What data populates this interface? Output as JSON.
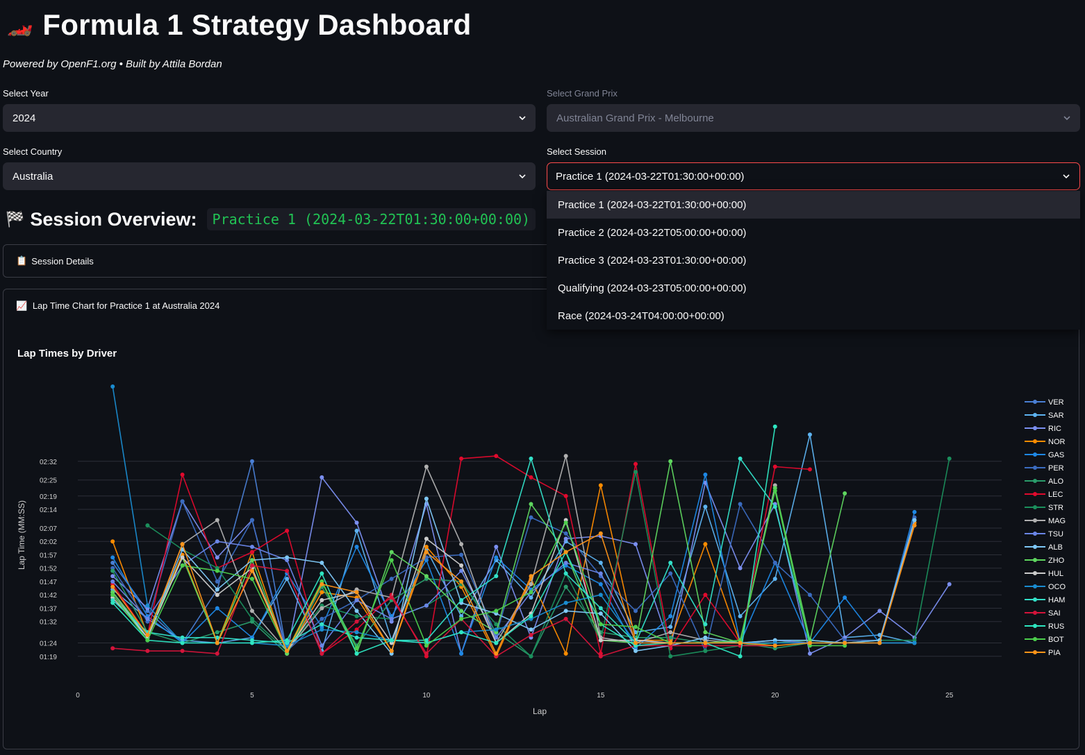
{
  "header": {
    "title": "Formula 1 Strategy Dashboard",
    "subtitle": "Powered by OpenF1.org • Built by Attila Bordan"
  },
  "controls": {
    "year": {
      "label": "Select Year",
      "value": "2024"
    },
    "grand_prix": {
      "label": "Select Grand Prix",
      "value": "Australian Grand Prix - Melbourne"
    },
    "country": {
      "label": "Select Country",
      "value": "Australia"
    },
    "session": {
      "label": "Select Session",
      "value": "Practice 1 (2024-03-22T01:30:00+00:00)"
    }
  },
  "session_options": [
    "Practice 1 (2024-03-22T01:30:00+00:00)",
    "Practice 2 (2024-03-22T05:00:00+00:00)",
    "Practice 3 (2024-03-23T01:30:00+00:00)",
    "Qualifying (2024-03-23T05:00:00+00:00)",
    "Race (2024-03-24T04:00:00+00:00)"
  ],
  "overview": {
    "heading": "Session Overview:",
    "session_code": "Practice 1 (2024-03-22T01:30:00+00:00)"
  },
  "expander": {
    "label": "Session Details"
  },
  "chart_panel": {
    "label": "Lap Time Chart for Practice 1 at Australia 2024"
  },
  "chart_data": {
    "type": "line",
    "title": "Lap Times by Driver",
    "xlabel": "Lap",
    "ylabel": "Lap Time (MM:SS)",
    "xlim": [
      0,
      26.5
    ],
    "ylim": [
      74,
      180
    ],
    "xticks": [
      0,
      5,
      10,
      15,
      20,
      25
    ],
    "yticks": [
      79,
      84,
      92,
      97,
      102,
      107,
      112,
      117,
      122,
      127,
      134,
      139,
      145,
      152
    ],
    "ytick_labels": [
      "01:19",
      "01:24",
      "01:32",
      "01:37",
      "01:42",
      "01:47",
      "01:52",
      "01:57",
      "02:02",
      "02:07",
      "02:14",
      "02:19",
      "02:25",
      "02:32"
    ],
    "legend_position": "right",
    "series": [
      {
        "name": "VER",
        "color": "#4a7fd4",
        "x": [
          1,
          2,
          3,
          4,
          5,
          6,
          7
        ],
        "y": [
          114,
          96,
          84,
          104,
          152,
          80,
          103
        ]
      },
      {
        "name": "SAR",
        "color": "#5db3f0",
        "x": [
          1,
          2,
          3,
          4,
          5,
          6,
          7,
          8,
          9,
          10,
          11,
          12,
          13,
          14,
          15,
          16,
          17,
          18,
          19,
          20,
          21,
          22,
          23,
          24
        ],
        "y": [
          104,
          93,
          85,
          84,
          86,
          108,
          81,
          126,
          85,
          119,
          94,
          115,
          101,
          122,
          114,
          88,
          90,
          135,
          94,
          108,
          162,
          86,
          87,
          84
        ]
      },
      {
        "name": "RIC",
        "color": "#7b8ff0",
        "x": [
          1,
          2,
          3,
          4,
          5,
          6,
          7,
          8,
          9,
          10,
          11,
          12,
          13,
          14,
          15,
          16,
          17,
          18,
          19,
          20,
          21,
          22,
          23,
          24,
          25
        ],
        "y": [
          109,
          97,
          137,
          116,
          130,
          80,
          146,
          129,
          92,
          136,
          80,
          120,
          86,
          123,
          124,
          121,
          82,
          144,
          112,
          136,
          80,
          86,
          96,
          86,
          106
        ]
      },
      {
        "name": "NOR",
        "color": "#ff8c00",
        "x": [
          1,
          2,
          3,
          4,
          5,
          6,
          7,
          8,
          9,
          10,
          11,
          12,
          13,
          14,
          15,
          16,
          17,
          18,
          19,
          20,
          21,
          22,
          23,
          24
        ],
        "y": [
          122,
          87,
          117,
          84,
          118,
          80,
          103,
          101,
          81,
          120,
          105,
          79,
          108,
          80,
          143,
          85,
          85,
          121,
          84,
          84,
          85,
          84,
          85,
          129
        ]
      },
      {
        "name": "GAS",
        "color": "#1e88e5",
        "x": [
          1,
          2,
          3,
          4,
          5,
          6,
          7,
          8,
          9,
          10,
          11,
          12,
          13,
          14,
          15,
          16,
          17,
          18,
          19,
          20,
          21,
          22,
          23,
          24
        ],
        "y": [
          116,
          94,
          84,
          97,
          86,
          110,
          90,
          120,
          94,
          115,
          80,
          116,
          104,
          113,
          106,
          82,
          94,
          147,
          84,
          114,
          84,
          101,
          84,
          133
        ]
      },
      {
        "name": "PER",
        "color": "#3b6cc0",
        "x": [
          1,
          2,
          3,
          4,
          5,
          6,
          7,
          8,
          9,
          10,
          11,
          12,
          13,
          14,
          15,
          16,
          17,
          18,
          19,
          20,
          21,
          22,
          23,
          24
        ],
        "y": [
          112,
          92,
          137,
          107,
          130,
          81,
          93,
          100,
          108,
          116,
          117,
          87,
          131,
          125,
          109,
          96,
          110,
          81,
          136,
          114,
          102,
          85,
          85,
          131
        ]
      },
      {
        "name": "ALO",
        "color": "#2a9d6b",
        "x": [
          1,
          2,
          3,
          4,
          5,
          6,
          7,
          8,
          9,
          10,
          11,
          12,
          13,
          14,
          15,
          16,
          17,
          18,
          19,
          20,
          21,
          22,
          23,
          24
        ],
        "y": [
          111,
          88,
          84,
          88,
          92,
          80,
          105,
          83,
          100,
          108,
          107,
          88,
          79,
          105,
          88,
          86,
          86,
          84,
          84,
          82,
          84,
          84,
          84,
          84
        ]
      },
      {
        "name": "LEC",
        "color": "#e10a2d",
        "x": [
          1,
          2,
          3,
          4,
          5,
          6,
          7,
          8,
          9,
          10,
          11,
          12,
          13,
          14,
          15,
          16,
          17,
          18,
          19,
          20,
          21
        ],
        "y": [
          106,
          87,
          147,
          112,
          118,
          126,
          80,
          89,
          102,
          79,
          153,
          154,
          146,
          139,
          80,
          151,
          82,
          102,
          84,
          150,
          149
        ]
      },
      {
        "name": "STR",
        "color": "#1b8f5c",
        "x": [
          2,
          3,
          4,
          5,
          6,
          7,
          8,
          9,
          10,
          11,
          12,
          13,
          14,
          15,
          16,
          17,
          18,
          19,
          20,
          21,
          22,
          23,
          24,
          25
        ],
        "y": [
          128,
          119,
          112,
          93,
          81,
          98,
          94,
          93,
          98,
          106,
          91,
          79,
          110,
          85,
          148,
          79,
          81,
          83,
          84,
          85,
          84,
          85,
          85,
          153
        ]
      },
      {
        "name": "MAG",
        "color": "#b0b0b0",
        "x": [
          1,
          2,
          3,
          4,
          5,
          6,
          7,
          8,
          9,
          10,
          11,
          12,
          13,
          14,
          15,
          16,
          17,
          18,
          19,
          20
        ],
        "y": [
          102,
          86,
          121,
          130,
          96,
          81,
          97,
          104,
          101,
          150,
          121,
          84,
          106,
          154,
          86,
          84,
          88,
          85,
          84,
          143
        ]
      },
      {
        "name": "TSU",
        "color": "#6b86e8",
        "x": [
          1,
          2,
          3,
          4,
          5,
          6,
          7,
          8,
          9,
          10,
          11,
          12,
          13,
          14,
          15,
          16,
          17,
          18,
          19,
          20,
          21,
          22,
          23,
          24
        ],
        "y": [
          107,
          93,
          113,
          122,
          120,
          115,
          83,
          100,
          93,
          98,
          111,
          86,
          103,
          114,
          110,
          85,
          84,
          84,
          84,
          85,
          84,
          84,
          84,
          84
        ]
      },
      {
        "name": "ALB",
        "color": "#7ec8f7",
        "x": [
          1,
          2,
          3,
          4,
          5,
          6,
          7,
          8,
          9,
          10,
          11,
          12,
          13,
          14,
          15,
          16,
          17,
          18,
          19,
          20,
          21,
          22,
          23,
          24
        ],
        "y": [
          103,
          86,
          119,
          104,
          115,
          116,
          114,
          96,
          80,
          138,
          99,
          95,
          89,
          96,
          95,
          81,
          83,
          86,
          84,
          85,
          85,
          84,
          85,
          130
        ]
      },
      {
        "name": "ZHO",
        "color": "#5fd65f",
        "x": [
          1,
          2,
          3,
          4,
          5,
          6,
          7,
          8,
          9,
          10,
          11,
          12,
          13,
          14,
          15,
          16,
          17,
          18,
          19,
          20,
          21,
          22
        ],
        "y": [
          103,
          87,
          116,
          84,
          115,
          80,
          107,
          80,
          118,
          109,
          96,
          88,
          136,
          118,
          85,
          84,
          152,
          88,
          84,
          142,
          85,
          140
        ]
      },
      {
        "name": "HUL",
        "color": "#cccccc",
        "x": [
          1,
          2,
          3,
          4,
          5,
          6,
          7,
          8,
          9,
          10,
          11,
          12,
          13,
          14,
          15,
          16,
          17,
          18,
          19,
          20
        ],
        "y": [
          101,
          86,
          116,
          102,
          112,
          81,
          100,
          103,
          84,
          123,
          113,
          84,
          95,
          130,
          85,
          85,
          84,
          84,
          84,
          84
        ]
      },
      {
        "name": "OCO",
        "color": "#1a8cd0",
        "x": [
          1,
          2,
          3,
          4,
          5,
          6,
          7,
          8,
          9,
          10,
          11,
          12,
          13,
          14,
          15,
          16,
          17,
          18,
          19,
          20,
          21,
          22,
          23,
          24
        ],
        "y": [
          180,
          98,
          84,
          84,
          84,
          83,
          89,
          88,
          85,
          84,
          88,
          89,
          93,
          99,
          102,
          84,
          84,
          84,
          84,
          84,
          84,
          84,
          84,
          84
        ]
      },
      {
        "name": "HAM",
        "color": "#33e0c8",
        "x": [
          1,
          2,
          3,
          4,
          5,
          6,
          7,
          8,
          9,
          10,
          11,
          12,
          13,
          14,
          15,
          16,
          17,
          18,
          19,
          20,
          21,
          22
        ],
        "y": [
          100,
          88,
          86,
          86,
          85,
          84,
          91,
          86,
          85,
          85,
          100,
          109,
          153,
          110,
          97,
          84,
          114,
          91,
          153,
          135,
          84,
          84
        ]
      },
      {
        "name": "SAI",
        "color": "#d4143a",
        "x": [
          1,
          2,
          3,
          4,
          5,
          6,
          7,
          8,
          9,
          10,
          11,
          12,
          13,
          14,
          15,
          16,
          17,
          18,
          19,
          20
        ],
        "y": [
          82,
          81,
          81,
          80,
          113,
          111,
          80,
          92,
          101,
          80,
          93,
          79,
          87,
          93,
          79,
          83,
          83,
          83,
          83,
          83
        ]
      },
      {
        "name": "RUS",
        "color": "#2ee6c1",
        "x": [
          1,
          2,
          3,
          4,
          5,
          6,
          7,
          8,
          9,
          10,
          11,
          12,
          13,
          14,
          15,
          16,
          17,
          18,
          19,
          20
        ],
        "y": [
          99,
          85,
          84,
          84,
          84,
          85,
          110,
          80,
          85,
          84,
          88,
          84,
          94,
          118,
          91,
          83,
          84,
          84,
          79,
          165
        ]
      },
      {
        "name": "BOT",
        "color": "#4ccf4c",
        "x": [
          1,
          2,
          3,
          4,
          5,
          6,
          7,
          8,
          9,
          10,
          11,
          12,
          13,
          14,
          15,
          16,
          17,
          18,
          19,
          20,
          21,
          22
        ],
        "y": [
          102,
          85,
          113,
          111,
          108,
          81,
          107,
          82,
          115,
          83,
          93,
          96,
          103,
          129,
          91,
          90,
          84,
          84,
          85,
          141,
          83,
          83
        ]
      },
      {
        "name": "PIA",
        "color": "#ff9419",
        "x": [
          1,
          2,
          3,
          4,
          5,
          6,
          7,
          8,
          9,
          10,
          11,
          12,
          13,
          14,
          15,
          16,
          17,
          18,
          19,
          20,
          21,
          22,
          23,
          24
        ],
        "y": [
          105,
          87,
          121,
          84,
          111,
          81,
          106,
          103,
          81,
          118,
          107,
          80,
          109,
          118,
          125,
          84,
          84,
          84,
          84,
          83,
          84,
          84,
          84,
          128
        ]
      }
    ]
  }
}
